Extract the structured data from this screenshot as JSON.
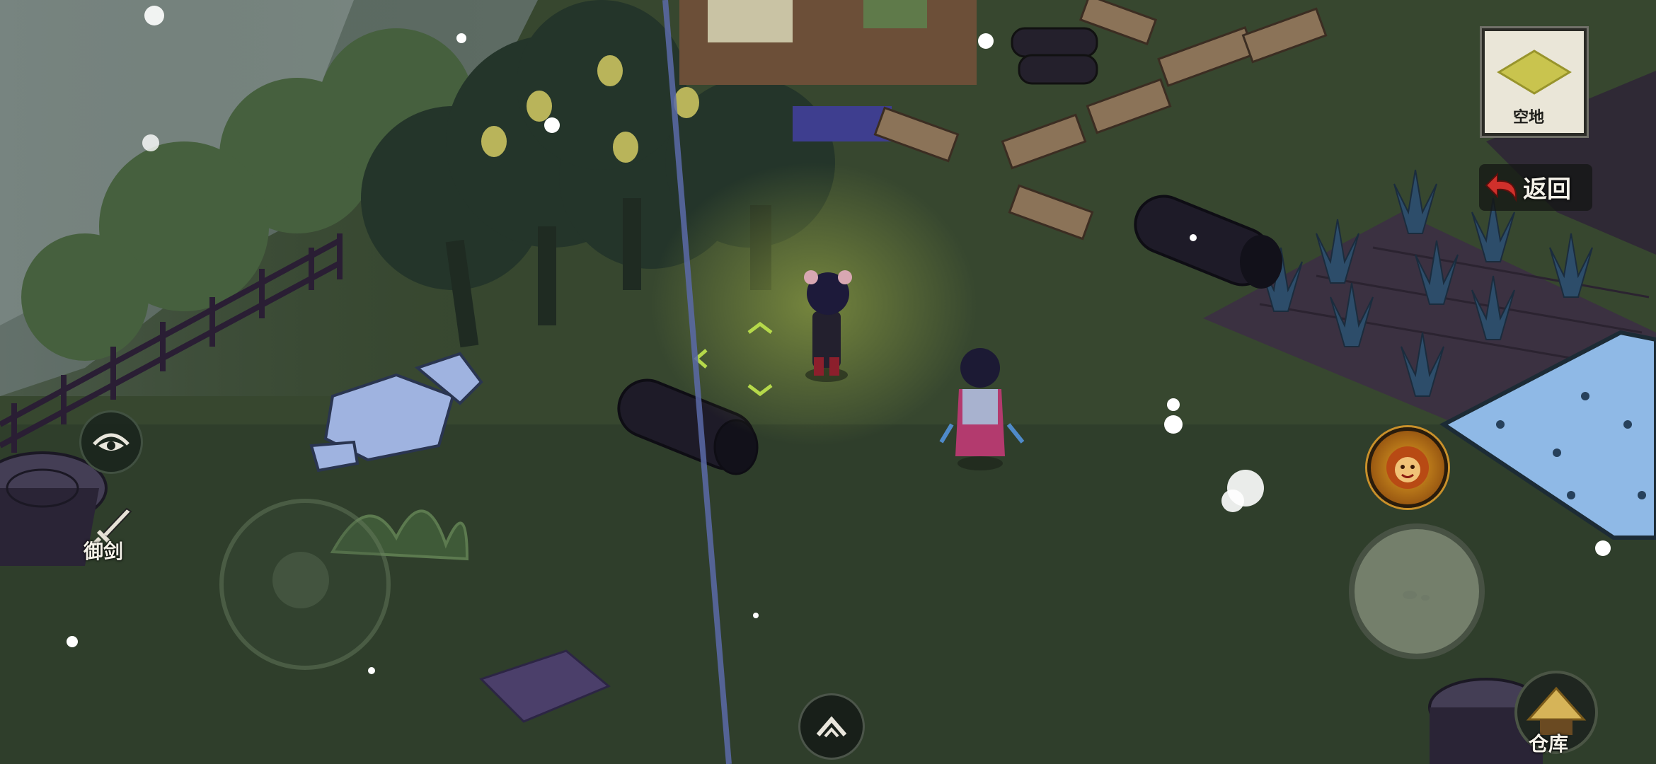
{
  "hud": {
    "view_toggle": {
      "icon": "eye-icon"
    },
    "sword_flight": {
      "icon": "sword-icon",
      "label": "御剑"
    },
    "joystick": {
      "icon": "virtual-joystick"
    },
    "tile_info": {
      "icon": "empty-plot-icon",
      "label": "空地"
    },
    "back": {
      "icon": "back-arrow-icon",
      "label": "返回"
    },
    "skill": {
      "icon": "lion-mask-icon"
    },
    "action": {
      "icon": "action-circle"
    },
    "storage": {
      "icon": "thatched-hut-icon",
      "label": "仓库"
    },
    "menu": {
      "icon": "chevron-up-icon"
    }
  },
  "colors": {
    "grass": "#3a4a35",
    "soil": "#3a3038",
    "water": "#8fb9e6",
    "accent_gold": "#d4a12a",
    "highlight_green": "#b5d94a"
  }
}
